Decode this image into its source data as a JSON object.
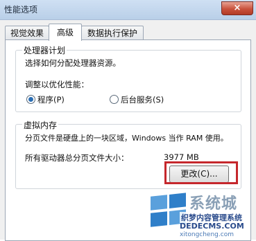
{
  "window": {
    "title": "性能选项",
    "close_glyph": "×"
  },
  "tabs": [
    {
      "label": "视觉效果"
    },
    {
      "label": "高级"
    },
    {
      "label": "数据执行保护"
    }
  ],
  "processor": {
    "group_title": "处理器计划",
    "description": "选择如何分配处理器资源。",
    "optimize_label": "调整以优化性能：",
    "options": [
      {
        "label": "程序(P)",
        "selected": true
      },
      {
        "label": "后台服务(S)",
        "selected": false
      }
    ]
  },
  "virtual_memory": {
    "group_title": "虚拟内存",
    "description": "分页文件是硬盘上的一块区域，Windows 当作 RAM 使用。",
    "total_label": "所有驱动器总分页文件大小：",
    "total_value": "3977 MB",
    "change_button": "更改(C)..."
  },
  "watermark": {
    "brand": "系统城",
    "tagline": "织梦内容管理系统",
    "url": "DEDECMS.COM",
    "sub": "xitongcheng.com"
  },
  "colors": {
    "highlight": "#c5272c",
    "accent": "#2b6fb5"
  }
}
